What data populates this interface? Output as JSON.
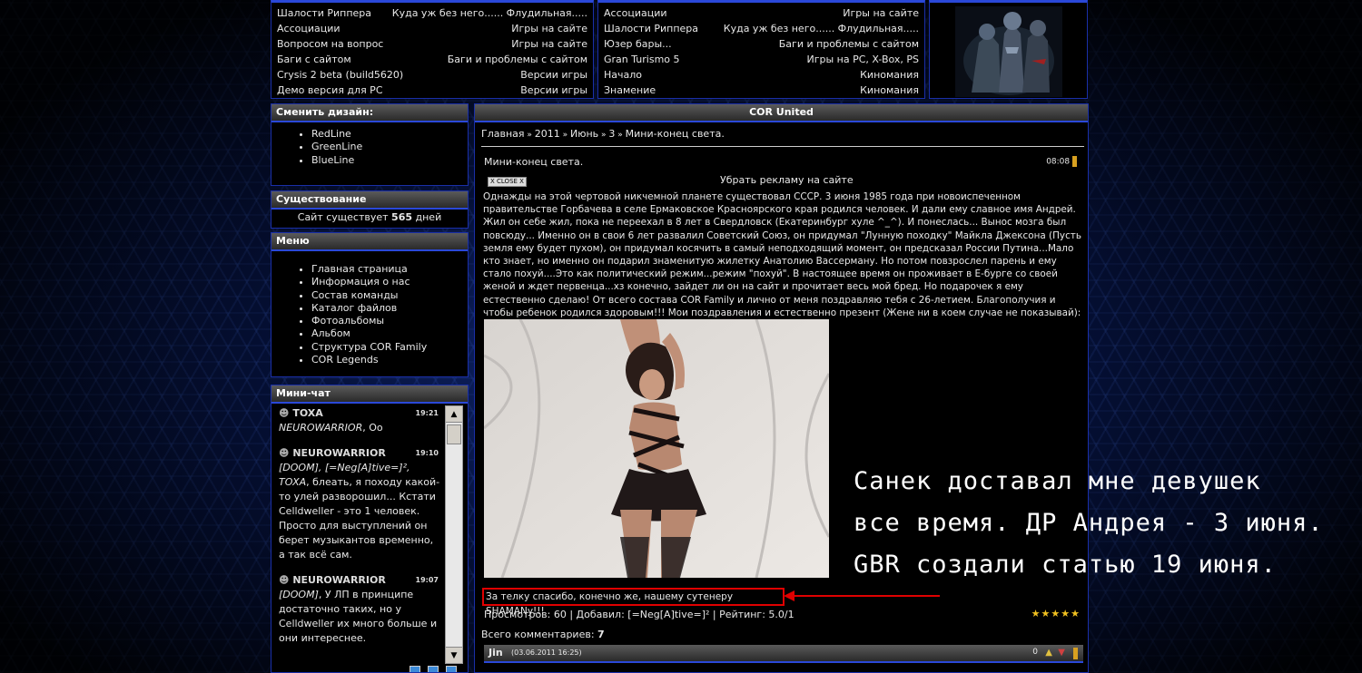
{
  "forum_recent": {
    "left": [
      {
        "topic": "Шалости Риппера",
        "section": "Куда уж без него...... Флудильная....."
      },
      {
        "topic": "Ассоциации",
        "section": "Игры на сайте"
      },
      {
        "topic": "Вопросом на вопрос",
        "section": "Игры на сайте"
      },
      {
        "topic": "Баги с сайтом",
        "section": "Баги и проблемы с сайтом"
      },
      {
        "topic": "Crysis 2 beta (build5620)",
        "section": "Версии игры"
      },
      {
        "topic": "Демо версия для PC",
        "section": "Версии игры"
      }
    ],
    "right": [
      {
        "topic": "Ассоциации",
        "section": "Игры на сайте"
      },
      {
        "topic": "Шалости Риппера",
        "section": "Куда уж без него...... Флудильная....."
      },
      {
        "topic": "Юзер бары...",
        "section": "Баги и проблемы с сайтом"
      },
      {
        "topic": "Gran Turismo 5",
        "section": "Игры на PC, X-Box, PS"
      },
      {
        "topic": "Начало",
        "section": "Киномания"
      },
      {
        "topic": "Знамение",
        "section": "Киномания"
      }
    ]
  },
  "design": {
    "title": "Сменить дизайн:",
    "items": [
      "RedLine",
      "GreenLine",
      "BlueLine"
    ]
  },
  "existence": {
    "title": "Существование",
    "prefix": "Сайт существует ",
    "days": "565",
    "suffix": " дней"
  },
  "menu": {
    "title": "Меню",
    "items": [
      "Главная страница",
      "Информация о нас",
      "Состав команды",
      "Каталог файлов",
      "Фотоальбомы",
      "Альбом",
      "Структура COR Family",
      "COR Legends"
    ]
  },
  "chat": {
    "title": "Мини-чат",
    "messages": [
      {
        "user": "TOXA",
        "time": "19:21",
        "addr": "NEUROWARRIOR",
        "text": ", Oo"
      },
      {
        "user": "NEUROWARRIOR",
        "time": "19:10",
        "addr": "[DOOM], [=Neg[A]tive=]², TOXA",
        "text": ", блеать, я походу какой-то улей разворошил... Кстати Celldweller - это 1 человек. Просто для выступлений он берет музыкантов временно, а так всё сам."
      },
      {
        "user": "NEUROWARRIOR",
        "time": "19:07",
        "addr": "[DOOM]",
        "text": ", У ЛП в принципе достаточно таких, но у Celldweller их много больше и они интереснее."
      }
    ]
  },
  "main": {
    "title": "COR United",
    "breadcrumb": [
      "Главная",
      "2011",
      "Июнь",
      "3",
      "Мини-конец света."
    ],
    "entry_title": "Мини-конец света.",
    "entry_time": "08:08",
    "close_ad": "X CLOSE X",
    "remove_ad": "Убрать рекламу на сайте",
    "body": "Однажды на этой чертовой никчемной планете существовал СССР. 3 июня 1985 года при новоиспеченном правительстве Горбачева в селе Ермаковское Красноярского края родился человек. И дали ему славное имя Андрей. Жил он себе жил, пока не переехал в 8 лет в Свердловск (Екатеринбург хуле ^_^). И понеслась... Вынос мозга был повсюду... Именно он в свои 6 лет развалил Советский Союз, он придумал \"Лунную походку\" Майкла Джексона (Пусть земля ему будет пухом), он придумал косячить в самый неподходящий момент, он предсказал России Путина...Мало кто знает, но именно он подарил знаменитую жилетку Анатолию Вассерману. Но потом повзрослел парень и ему стало похуй....Это как политический режим...режим \"похуй\". В настоящее время он проживает в Е-бурге со своей женой и ждет первенца...хз конечно, зайдет ли он на сайт и прочитает весь мой бред. Но подарочек я ему естественно сделаю! От всего состава COR Family и лично от меня поздравляю тебя с 26-летием. Благополучия и чтобы ребенок родился здоровым!!! Мои поздравления и естественно презент (Жене ни в коем случае не показывай):",
    "thanks": "За телку спасибо, конечно же, нашему сутенеру SHAMANу!!!",
    "stats": "Просмотров: 60 | Добавил: [=Neg[A]tive=]² | Рейтинг: 5.0/1",
    "rating_stars": 5,
    "comments_label": "Всего комментариев: ",
    "comments_count": "7",
    "comment": {
      "user": "Jin",
      "date": "(03.06.2011 16:25)",
      "votes": "0"
    }
  },
  "overlay_text": [
    "Санек доставал мне девушек",
    "все время. ДР Андрея - 3 июня.",
    "GBR создали статью 19 июня."
  ],
  "colors": {
    "border_blue": "#2a48d8",
    "annotation_red": "#e00000",
    "star": "#f0c020"
  }
}
